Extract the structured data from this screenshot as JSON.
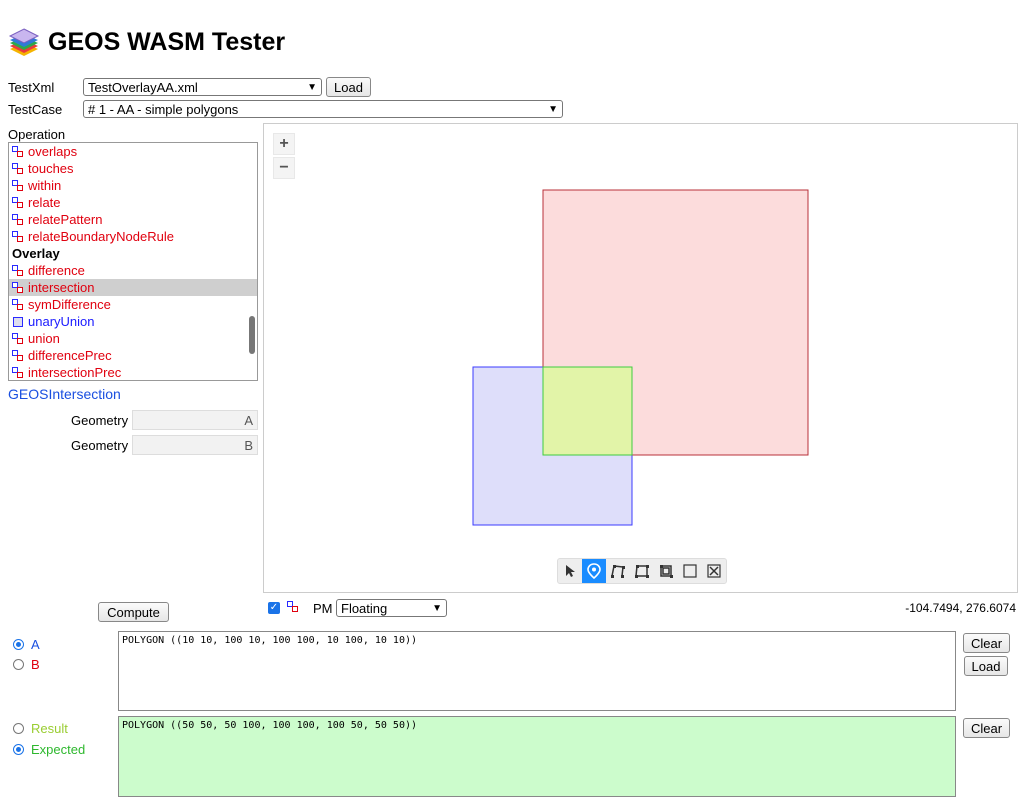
{
  "app": {
    "title": "GEOS WASM Tester"
  },
  "controls": {
    "testxml_label": "TestXml",
    "testxml_value": "TestOverlayAA.xml",
    "load_label": "Load",
    "testcase_label": "TestCase",
    "testcase_value": "# 1 - AA - simple polygons",
    "operation_label": "Operation"
  },
  "operations": [
    {
      "label": "overlaps",
      "kind": "binary"
    },
    {
      "label": "touches",
      "kind": "binary"
    },
    {
      "label": "within",
      "kind": "binary"
    },
    {
      "label": "relate",
      "kind": "binary"
    },
    {
      "label": "relatePattern",
      "kind": "binary"
    },
    {
      "label": "relateBoundaryNodeRule",
      "kind": "binary"
    },
    {
      "label": "Overlay",
      "kind": "group"
    },
    {
      "label": "difference",
      "kind": "binary"
    },
    {
      "label": "intersection",
      "kind": "binary",
      "selected": true
    },
    {
      "label": "symDifference",
      "kind": "binary"
    },
    {
      "label": "unaryUnion",
      "kind": "unary"
    },
    {
      "label": "union",
      "kind": "binary"
    },
    {
      "label": "differencePrec",
      "kind": "binary"
    },
    {
      "label": "intersectionPrec",
      "kind": "binary"
    }
  ],
  "function_name": "GEOSIntersection",
  "geometry_params": [
    {
      "label": "Geometry",
      "value": "A"
    },
    {
      "label": "Geometry",
      "value": "B"
    }
  ],
  "compute_label": "Compute",
  "map": {
    "zoom_in": "+",
    "zoom_out": "−",
    "tools": [
      "select-arrow-icon",
      "point-marker-icon",
      "line-draw-icon",
      "polygon-draw-icon",
      "modify-icon",
      "rectangle-icon",
      "fullscreen-icon"
    ],
    "active_tool": 1,
    "colors": {
      "a_fill": "#dedefa",
      "a_stroke": "#3b3bff",
      "b_fill": "#fcdcdc",
      "b_stroke": "#b8303a",
      "result_fill": "#e2f4a8",
      "result_stroke": "#3fcc3f"
    }
  },
  "pm": {
    "label": "PM",
    "value": "Floating",
    "coords": "-104.7494, 276.6074"
  },
  "inputs": {
    "a_label": "A",
    "b_label": "B",
    "a_wkt": "POLYGON ((10 10, 100 10, 100 100, 10 100, 10 10))",
    "clear_label": "Clear",
    "load_label": "Load",
    "result_label": "Result",
    "expected_label": "Expected",
    "expected_wkt": "POLYGON ((50 50, 50 100, 100 100, 100 50, 50 50))"
  }
}
